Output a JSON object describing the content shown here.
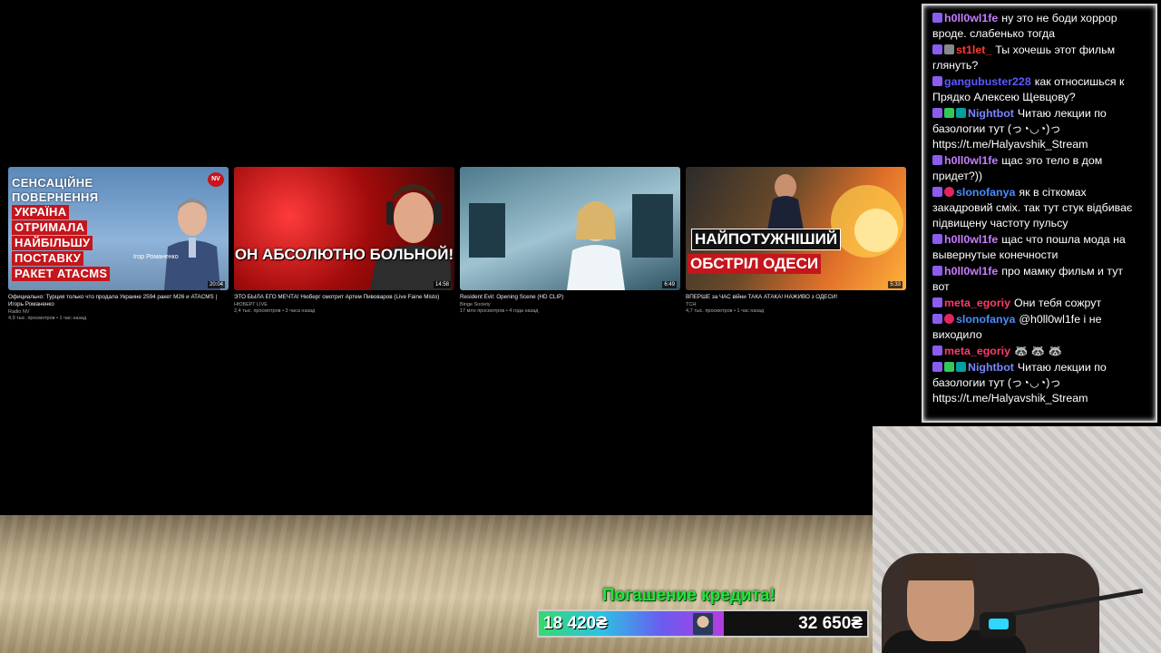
{
  "recommendations": [
    {
      "thumb_lines": [
        "СЕНСАЦІЙНЕ",
        "ПОВЕРНЕННЯ"
      ],
      "thumb_red_lines": [
        "УКРАЇНА",
        "ОТРИМАЛА",
        "НАЙБІЛЬШУ",
        "ПОСТАВКУ",
        "РАКЕТ ATACMS"
      ],
      "thumb_badge": "NV",
      "thumb_person_caption": "Ігор Романенко",
      "duration": "20:04",
      "title": "Официально: Турция только что продала Украине 2594 ракет М26 и ATACMS | Игорь Романенко",
      "channel": "Radio NV",
      "meta": "4,9 тыс. просмотров • 1 час назад"
    },
    {
      "thumb_caption": "ОН АБСОЛЮТНО БОЛЬНОЙ!",
      "duration": "14:58",
      "title": "ЭТО БЫЛА ЕГО МЕЧТА! Нюберг смотрит Артем Пивоваров (Live Faine Misto)",
      "channel": "НЮБЕРГ LIVE",
      "meta": "2,4 тыс. просмотров • 3 часа назад"
    },
    {
      "duration": "6:49",
      "title": "Resident Evil: Opening Scene (HD CLIP)",
      "channel": "Binge Society",
      "meta": "17 млн просмотров • 4 года назад"
    },
    {
      "thumb_line1": "НАЙПОТУЖНІШИЙ",
      "thumb_line2": "ОБСТРІЛ ОДЕСИ",
      "duration": "5:33",
      "title": "ВПЕРШЕ за ЧАС війни ТАКА АТАКА! НАЖИВО з ОДЕСИ!",
      "channel": "ТСН",
      "meta": "4,7 тыс. просмотров • 1 час назад"
    }
  ],
  "credit_widget": {
    "title": "Погашение кредита!",
    "current": "18 420₴",
    "goal": "32 650₴",
    "progress_fraction": 0.564
  },
  "chat": [
    {
      "badges": [
        "sub"
      ],
      "user": "h0ll0wl1fe",
      "color": "#c77dff",
      "text": "ну это не боди хоррор вроде. слабенько тогда"
    },
    {
      "badges": [
        "sub",
        "mute"
      ],
      "user": "st1let_",
      "color": "#ff3b30",
      "text": "Ты хочешь этот фильм глянуть?"
    },
    {
      "badges": [
        "sub"
      ],
      "user": "gangubuster228",
      "color": "#5b5bff",
      "text": "как относишься к Прядко Алексею Щевцову?"
    },
    {
      "badges": [
        "sub",
        "mod",
        "bot"
      ],
      "user": "Nightbot",
      "color": "#7a86ff",
      "text": "Читаю лекции по базологии тут (っ◔◡◔)っ https://t.me/Halyavshik_Stream"
    },
    {
      "badges": [
        "sub"
      ],
      "user": "h0ll0wl1fe",
      "color": "#c77dff",
      "text": "щас это тело в дом придет?))"
    },
    {
      "badges": [
        "sub",
        "vip"
      ],
      "user": "slonofanya",
      "color": "#4a8cff",
      "text": "як в сіткомах закадровий сміх. так тут стук відбиває підвищену частоту пульсу"
    },
    {
      "badges": [
        "sub"
      ],
      "user": "h0ll0wl1fe",
      "color": "#c77dff",
      "text": "щас что пошла мода на вывернутые конечности"
    },
    {
      "badges": [
        "sub"
      ],
      "user": "h0ll0wl1fe",
      "color": "#c77dff",
      "text": "про мамку фильм и тут вот"
    },
    {
      "badges": [
        "sub"
      ],
      "user": "meta_egoriy",
      "color": "#ff3b6b",
      "text": "Они тебя сожрут"
    },
    {
      "badges": [
        "sub",
        "vip"
      ],
      "user": "slonofanya",
      "color": "#4a8cff",
      "text": "@h0ll0wl1fe і не виходило"
    },
    {
      "badges": [
        "sub"
      ],
      "user": "meta_egoriy",
      "color": "#ff3b6b",
      "text": "🦝 🦝 🦝"
    },
    {
      "badges": [
        "sub",
        "mod",
        "bot"
      ],
      "user": "Nightbot",
      "color": "#7a86ff",
      "text": "Читаю лекции по базологии тут (っ◔◡◔)っ https://t.me/Halyavshik_Stream"
    }
  ],
  "colors": {
    "credit_title": "#1ee83a",
    "youtube_red": "#c4161c"
  }
}
